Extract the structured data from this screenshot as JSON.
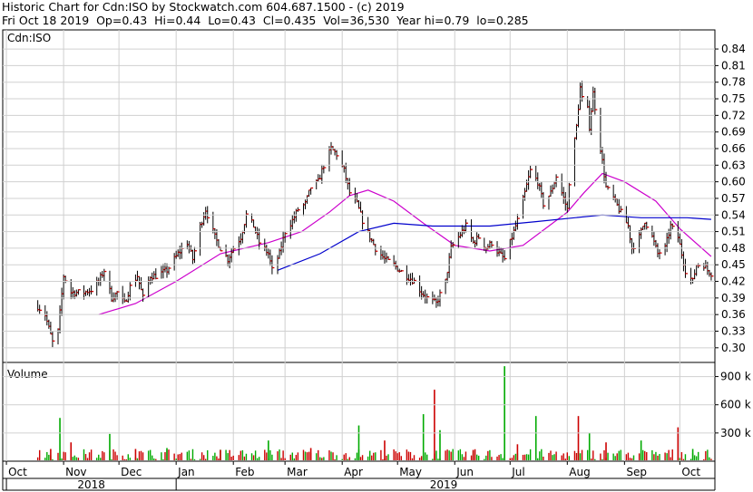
{
  "header": {
    "line1": "Historic Chart for Cdn:ISO by Stockwatch.com 604.687.1500 - (c) 2019",
    "line2": "Fri Oct 18 2019  Op=0.43  Hi=0.44  Lo=0.43  Cl=0.435  Vol=36,530  Year hi=0.79  lo=0.285"
  },
  "chart_data": {
    "type": "bar",
    "symbol_label": "Cdn:ISO",
    "volume_label": "Volume",
    "price_axis": {
      "ticks": [
        0.3,
        0.33,
        0.36,
        0.39,
        0.42,
        0.45,
        0.48,
        0.51,
        0.54,
        0.57,
        0.6,
        0.63,
        0.66,
        0.69,
        0.72,
        0.75,
        0.78,
        0.81,
        0.84
      ],
      "tick_labels": [
        "0.30",
        "0.33",
        "0.36",
        "0.39",
        "0.42",
        "0.45",
        "0.48",
        "0.51",
        "0.54",
        "0.57",
        "0.60",
        "0.63",
        "0.66",
        "0.69",
        "0.72",
        "0.75",
        "0.78",
        "0.81",
        "0.84"
      ],
      "ylim": [
        0.2735,
        0.8745
      ]
    },
    "volume_axis": {
      "ticks": [
        300000,
        600000,
        900000
      ],
      "tick_labels": [
        "300 k",
        "600 k",
        "900 k"
      ],
      "ylim": [
        0,
        1050000
      ]
    },
    "months": [
      {
        "label": "Oct",
        "date": "2018-10-01"
      },
      {
        "label": "Nov",
        "date": "2018-11-01"
      },
      {
        "label": "Dec",
        "date": "2018-12-01"
      },
      {
        "label": "Jan",
        "date": "2019-01-01"
      },
      {
        "label": "Feb",
        "date": "2019-02-01"
      },
      {
        "label": "Mar",
        "date": "2019-03-01"
      },
      {
        "label": "Apr",
        "date": "2019-04-01"
      },
      {
        "label": "May",
        "date": "2019-05-01"
      },
      {
        "label": "Jun",
        "date": "2019-06-01"
      },
      {
        "label": "Jul",
        "date": "2019-07-01"
      },
      {
        "label": "Aug",
        "date": "2019-08-01"
      },
      {
        "label": "Sep",
        "date": "2019-09-01"
      },
      {
        "label": "Oct",
        "date": "2019-10-01"
      }
    ],
    "years": [
      {
        "label": "2018",
        "from": "2018-10-01",
        "to": "2019-01-01"
      },
      {
        "label": "2019",
        "from": "2019-01-01",
        "to": "2019-10-18"
      }
    ],
    "price_series": {
      "name": "price",
      "points": [
        [
          "2018-10-18",
          0.375
        ],
        [
          "2018-10-22",
          0.36
        ],
        [
          "2018-10-26",
          0.31
        ],
        [
          "2018-10-29",
          0.33
        ],
        [
          "2018-11-01",
          0.43
        ],
        [
          "2018-11-05",
          0.4
        ],
        [
          "2018-11-08",
          0.4
        ],
        [
          "2018-11-12",
          0.4
        ],
        [
          "2018-11-16",
          0.405
        ],
        [
          "2018-11-20",
          0.42
        ],
        [
          "2018-11-23",
          0.44
        ],
        [
          "2018-11-27",
          0.39
        ],
        [
          "2018-11-30",
          0.4
        ],
        [
          "2018-12-04",
          0.38
        ],
        [
          "2018-12-07",
          0.41
        ],
        [
          "2018-12-11",
          0.43
        ],
        [
          "2018-12-14",
          0.39
        ],
        [
          "2018-12-18",
          0.43
        ],
        [
          "2018-12-21",
          0.43
        ],
        [
          "2018-12-27",
          0.44
        ],
        [
          "2019-01-02",
          0.47
        ],
        [
          "2019-01-07",
          0.49
        ],
        [
          "2019-01-10",
          0.46
        ],
        [
          "2019-01-14",
          0.52
        ],
        [
          "2019-01-17",
          0.55
        ],
        [
          "2019-01-22",
          0.5
        ],
        [
          "2019-01-25",
          0.48
        ],
        [
          "2019-01-29",
          0.46
        ],
        [
          "2019-02-01",
          0.48
        ],
        [
          "2019-02-05",
          0.5
        ],
        [
          "2019-02-08",
          0.54
        ],
        [
          "2019-02-12",
          0.52
        ],
        [
          "2019-02-15",
          0.49
        ],
        [
          "2019-02-20",
          0.47
        ],
        [
          "2019-02-22",
          0.44
        ],
        [
          "2019-02-26",
          0.47
        ],
        [
          "2019-03-01",
          0.51
        ],
        [
          "2019-03-05",
          0.53
        ],
        [
          "2019-03-08",
          0.55
        ],
        [
          "2019-03-12",
          0.56
        ],
        [
          "2019-03-15",
          0.59
        ],
        [
          "2019-03-19",
          0.6
        ],
        [
          "2019-03-22",
          0.63
        ],
        [
          "2019-03-26",
          0.66
        ],
        [
          "2019-03-29",
          0.65
        ],
        [
          "2019-04-02",
          0.62
        ],
        [
          "2019-04-05",
          0.58
        ],
        [
          "2019-04-09",
          0.56
        ],
        [
          "2019-04-12",
          0.53
        ],
        [
          "2019-04-16",
          0.5
        ],
        [
          "2019-04-19",
          0.48
        ],
        [
          "2019-04-24",
          0.46
        ],
        [
          "2019-04-29",
          0.45
        ],
        [
          "2019-05-02",
          0.44
        ],
        [
          "2019-05-06",
          0.43
        ],
        [
          "2019-05-10",
          0.42
        ],
        [
          "2019-05-14",
          0.4
        ],
        [
          "2019-05-17",
          0.39
        ],
        [
          "2019-05-22",
          0.38
        ],
        [
          "2019-05-27",
          0.42
        ],
        [
          "2019-05-30",
          0.48
        ],
        [
          "2019-06-03",
          0.5
        ],
        [
          "2019-06-07",
          0.52
        ],
        [
          "2019-06-11",
          0.49
        ],
        [
          "2019-06-14",
          0.5
        ],
        [
          "2019-06-18",
          0.48
        ],
        [
          "2019-06-21",
          0.49
        ],
        [
          "2019-06-25",
          0.47
        ],
        [
          "2019-06-28",
          0.46
        ],
        [
          "2019-07-02",
          0.5
        ],
        [
          "2019-07-05",
          0.53
        ],
        [
          "2019-07-09",
          0.58
        ],
        [
          "2019-07-12",
          0.62
        ],
        [
          "2019-07-16",
          0.6
        ],
        [
          "2019-07-19",
          0.56
        ],
        [
          "2019-07-23",
          0.58
        ],
        [
          "2019-07-26",
          0.61
        ],
        [
          "2019-07-30",
          0.57
        ],
        [
          "2019-08-01",
          0.55
        ],
        [
          "2019-08-02",
          0.6
        ],
        [
          "2019-08-06",
          0.7
        ],
        [
          "2019-08-08",
          0.77
        ],
        [
          "2019-08-09",
          0.75
        ],
        [
          "2019-08-12",
          0.73
        ],
        [
          "2019-08-13",
          0.7
        ],
        [
          "2019-08-15",
          0.76
        ],
        [
          "2019-08-19",
          0.66
        ],
        [
          "2019-08-22",
          0.59
        ],
        [
          "2019-08-26",
          0.57
        ],
        [
          "2019-08-29",
          0.55
        ],
        [
          "2019-09-03",
          0.52
        ],
        [
          "2019-09-05",
          0.48
        ],
        [
          "2019-09-09",
          0.5
        ],
        [
          "2019-09-12",
          0.53
        ],
        [
          "2019-09-16",
          0.5
        ],
        [
          "2019-09-19",
          0.47
        ],
        [
          "2019-09-23",
          0.48
        ],
        [
          "2019-09-26",
          0.52
        ],
        [
          "2019-09-30",
          0.5
        ],
        [
          "2019-10-02",
          0.47
        ],
        [
          "2019-10-04",
          0.44
        ],
        [
          "2019-10-08",
          0.42
        ],
        [
          "2019-10-10",
          0.45
        ],
        [
          "2019-10-14",
          0.45
        ],
        [
          "2019-10-16",
          0.44
        ],
        [
          "2019-10-18",
          0.435
        ]
      ]
    },
    "moving_averages": [
      {
        "color": "#cc00cc",
        "points": [
          [
            "2018-11-20",
            0.36
          ],
          [
            "2018-12-10",
            0.38
          ],
          [
            "2019-01-01",
            0.42
          ],
          [
            "2019-01-25",
            0.47
          ],
          [
            "2019-02-20",
            0.49
          ],
          [
            "2019-03-10",
            0.51
          ],
          [
            "2019-03-25",
            0.545
          ],
          [
            "2019-04-05",
            0.575
          ],
          [
            "2019-04-15",
            0.585
          ],
          [
            "2019-04-29",
            0.565
          ],
          [
            "2019-05-15",
            0.525
          ],
          [
            "2019-06-01",
            0.485
          ],
          [
            "2019-06-20",
            0.475
          ],
          [
            "2019-07-08",
            0.485
          ],
          [
            "2019-07-20",
            0.515
          ],
          [
            "2019-08-01",
            0.545
          ],
          [
            "2019-08-10",
            0.58
          ],
          [
            "2019-08-20",
            0.615
          ],
          [
            "2019-09-01",
            0.6
          ],
          [
            "2019-09-18",
            0.565
          ],
          [
            "2019-10-01",
            0.515
          ],
          [
            "2019-10-18",
            0.465
          ]
        ]
      },
      {
        "color": "#0000cc",
        "points": [
          [
            "2019-02-25",
            0.44
          ],
          [
            "2019-03-20",
            0.47
          ],
          [
            "2019-04-10",
            0.51
          ],
          [
            "2019-04-29",
            0.525
          ],
          [
            "2019-05-20",
            0.52
          ],
          [
            "2019-06-20",
            0.52
          ],
          [
            "2019-07-15",
            0.528
          ],
          [
            "2019-08-05",
            0.535
          ],
          [
            "2019-08-20",
            0.54
          ],
          [
            "2019-09-10",
            0.535
          ],
          [
            "2019-10-05",
            0.535
          ],
          [
            "2019-10-18",
            0.532
          ]
        ]
      }
    ],
    "volume": [
      [
        "2018-10-25",
        130000
      ],
      [
        "2018-10-30",
        460000
      ],
      [
        "2018-11-05",
        200000
      ],
      [
        "2018-11-26",
        290000
      ],
      [
        "2018-12-10",
        130000
      ],
      [
        "2018-12-27",
        140000
      ],
      [
        "2019-01-25",
        120000
      ],
      [
        "2019-02-20",
        220000
      ],
      [
        "2019-03-15",
        140000
      ],
      [
        "2019-04-10",
        380000
      ],
      [
        "2019-04-24",
        220000
      ],
      [
        "2019-05-15",
        500000
      ],
      [
        "2019-05-21",
        760000
      ],
      [
        "2019-05-24",
        330000
      ],
      [
        "2019-06-11",
        120000
      ],
      [
        "2019-06-28",
        1010000
      ],
      [
        "2019-07-05",
        180000
      ],
      [
        "2019-07-15",
        480000
      ],
      [
        "2019-08-07",
        480000
      ],
      [
        "2019-08-13",
        300000
      ],
      [
        "2019-08-22",
        200000
      ],
      [
        "2019-09-10",
        220000
      ],
      [
        "2019-09-30",
        360000
      ],
      [
        "2019-10-08",
        130000
      ]
    ]
  }
}
